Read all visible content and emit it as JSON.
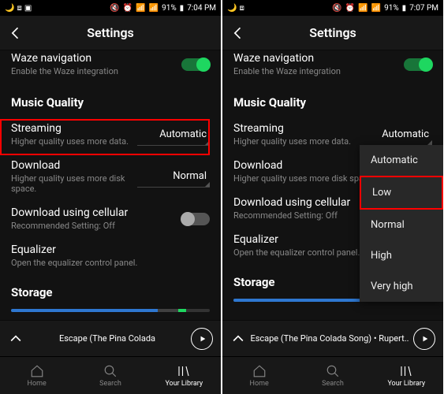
{
  "left": {
    "status": {
      "battery": "91%",
      "time": "7:04 PM"
    },
    "title": "Settings",
    "waze": {
      "title": "Waze navigation",
      "sub": "Enable the Waze integration"
    },
    "section_music": "Music Quality",
    "streaming": {
      "title": "Streaming",
      "sub": "Higher quality uses more data.",
      "value": "Automatic"
    },
    "download": {
      "title": "Download",
      "sub": "Higher quality uses more disk space.",
      "value": "Normal"
    },
    "cellular": {
      "title": "Download using cellular",
      "sub": "Recommended Setting: Off"
    },
    "equalizer": {
      "title": "Equalizer",
      "sub": "Open the equalizer control panel."
    },
    "storage": "Storage",
    "nowplaying": "Escape (The Pina Colada",
    "nav": {
      "home": "Home",
      "search": "Search",
      "library": "Your Library"
    }
  },
  "right": {
    "status": {
      "battery": "91%",
      "time": "7:07 PM"
    },
    "title": "Settings",
    "waze": {
      "title": "Waze navigation",
      "sub": "Enable the Waze integration"
    },
    "section_music": "Music Quality",
    "streaming": {
      "title": "Streaming",
      "sub": "Higher quality uses more data.",
      "value": "Automatic"
    },
    "download": {
      "title": "Download",
      "sub": "Higher quality uses more disk space."
    },
    "cellular": {
      "title": "Download using cellular",
      "sub": "Recommended Setting: Off"
    },
    "equalizer": {
      "title": "Equalizer",
      "sub": "Open the equalizer control panel."
    },
    "storage": "Storage",
    "menu": {
      "auto": "Automatic",
      "low": "Low",
      "normal": "Normal",
      "high": "High",
      "veryhigh": "Very high"
    },
    "nowplaying": "Escape (The Pina Colada Song) • Rupert..",
    "nav": {
      "home": "Home",
      "search": "Search",
      "library": "Your Library"
    }
  }
}
